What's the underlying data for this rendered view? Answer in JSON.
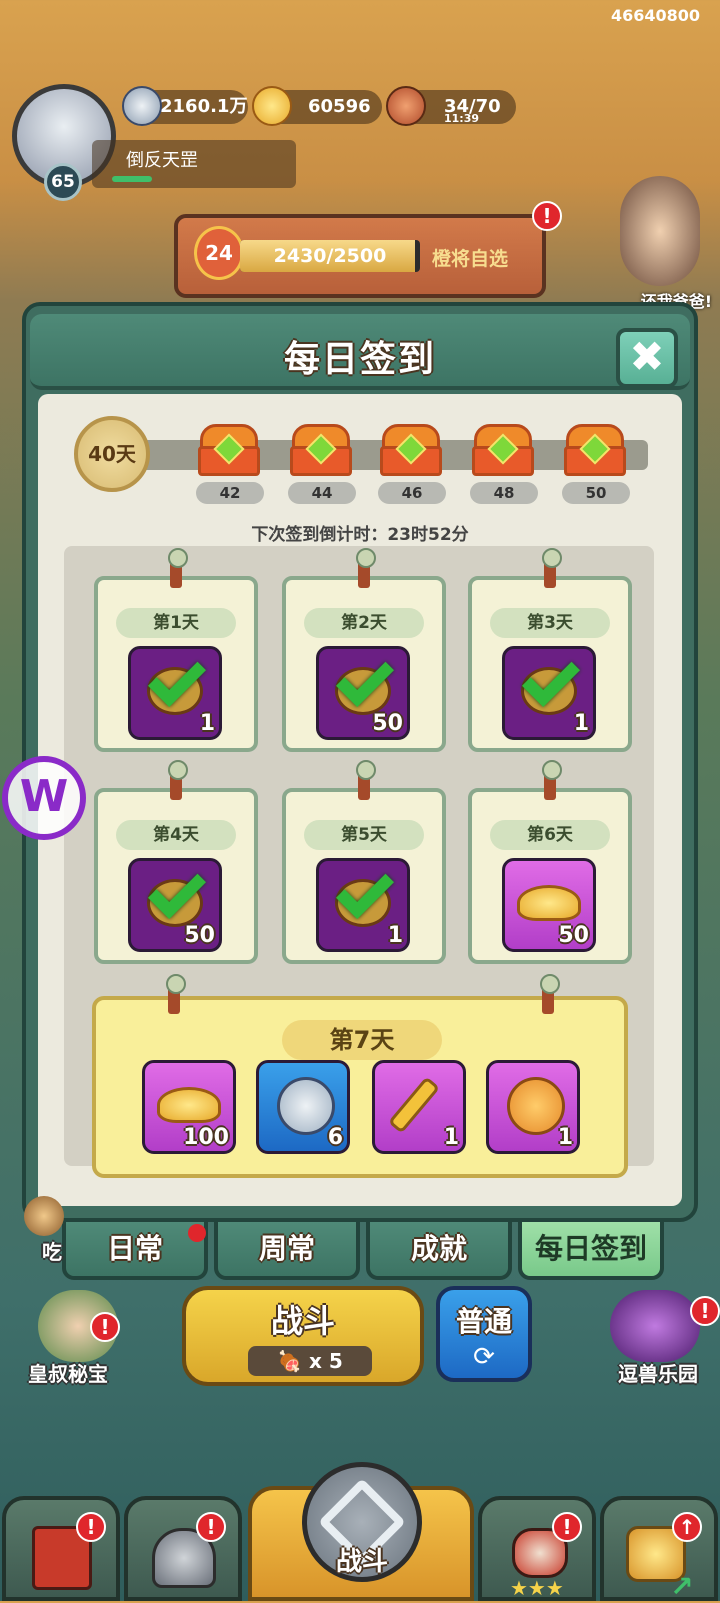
{
  "account_id": "46640800",
  "player": {
    "level": "65",
    "name": "倒反天罡",
    "avatar": "player-avatar"
  },
  "resources": {
    "silver": "2160.1万",
    "gold": "60596",
    "stamina": "34/70",
    "stamina_timer": "11:39"
  },
  "banner": {
    "level": "24",
    "progress_text": "2430/2500",
    "progress": 0.972,
    "label": "橙将自选"
  },
  "side_right": {
    "event_label": "还我爸爸!"
  },
  "dialog": {
    "title": "每日签到",
    "close_icon": "close-icon",
    "streak_days": "40天",
    "milestones": [
      "42",
      "44",
      "46",
      "48",
      "50"
    ],
    "countdown": "下次签到倒计时：23时52分",
    "days": [
      {
        "label": "第1天",
        "item": "food-icon",
        "qty": "1",
        "claimed": true,
        "style": "dark"
      },
      {
        "label": "第2天",
        "item": "heart-icon",
        "qty": "50",
        "claimed": true,
        "style": "dark"
      },
      {
        "label": "第3天",
        "item": "food-icon",
        "qty": "1",
        "claimed": true,
        "style": "dark"
      },
      {
        "label": "第4天",
        "item": "heart-icon",
        "qty": "50",
        "claimed": true,
        "style": "dark"
      },
      {
        "label": "第5天",
        "item": "food-icon",
        "qty": "1",
        "claimed": true,
        "style": "dark"
      },
      {
        "label": "第6天",
        "item": "gold-ingot-icon",
        "qty": "50",
        "claimed": false,
        "style": "pink"
      }
    ],
    "day7": {
      "label": "第7天",
      "rewards": [
        {
          "item": "gold-ingot-icon",
          "qty": "100",
          "style": "pink"
        },
        {
          "item": "silver-coin-icon",
          "qty": "6",
          "style": "blue"
        },
        {
          "item": "key-icon",
          "qty": "1",
          "style": "pink"
        },
        {
          "item": "heart-coin-icon",
          "qty": "1",
          "style": "pink"
        }
      ]
    }
  },
  "tabs": [
    "日常",
    "周常",
    "成就",
    "每日签到"
  ],
  "battle": {
    "label": "战斗",
    "cost": "x 5",
    "mode": "普通"
  },
  "corner_left": {
    "label": "皇叔秘宝",
    "top_label": "吃"
  },
  "corner_right": {
    "label": "逗兽乐园"
  },
  "bottom_nav": {
    "center_label": "战斗"
  },
  "colors": {
    "panel": "#3f6d60",
    "tab_active": "#79c98a",
    "gold_btn": "#f5d34a",
    "blue_btn": "#1d69c4",
    "badge": "#e0262c"
  }
}
